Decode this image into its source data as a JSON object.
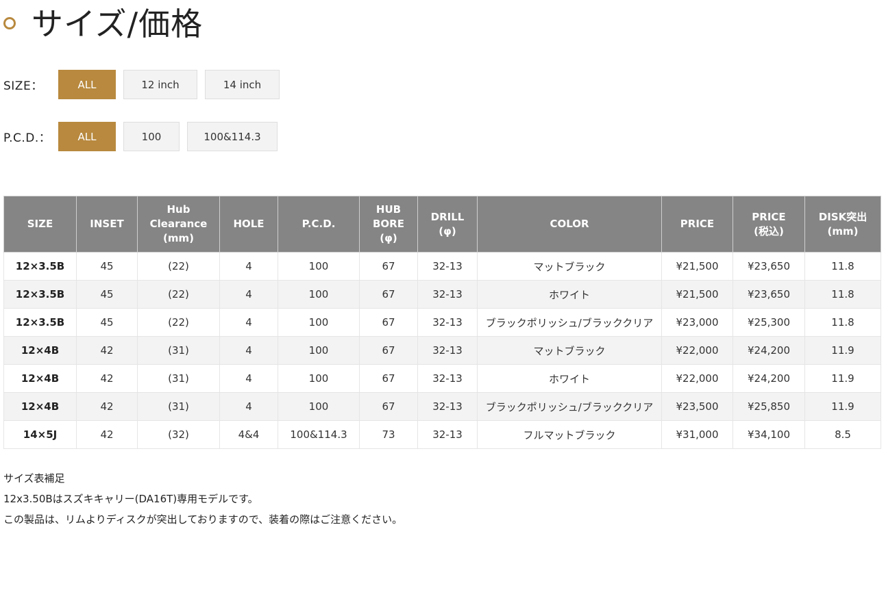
{
  "page_title": "サイズ/価格",
  "filters": {
    "size": {
      "label": "SIZE：",
      "options": [
        "ALL",
        "12 inch",
        "14 inch"
      ],
      "selected": "ALL"
    },
    "pcd": {
      "label": "P.C.D.：",
      "options": [
        "ALL",
        "100",
        "100&114.3"
      ],
      "selected": "ALL"
    }
  },
  "table": {
    "headers": [
      [
        "SIZE"
      ],
      [
        "INSET"
      ],
      [
        "Hub",
        "Clearance",
        "(mm)"
      ],
      [
        "HOLE"
      ],
      [
        "P.C.D."
      ],
      [
        "HUB",
        "BORE",
        "(φ)"
      ],
      [
        "DRILL",
        "(φ)"
      ],
      [
        "COLOR"
      ],
      [
        "PRICE"
      ],
      [
        "PRICE",
        "(税込)"
      ],
      [
        "DISK突出",
        "(mm)"
      ]
    ],
    "rows": [
      [
        "12×3.5B",
        "45",
        "(22)",
        "4",
        "100",
        "67",
        "32-13",
        "マットブラック",
        "¥21,500",
        "¥23,650",
        "11.8"
      ],
      [
        "12×3.5B",
        "45",
        "(22)",
        "4",
        "100",
        "67",
        "32-13",
        "ホワイト",
        "¥21,500",
        "¥23,650",
        "11.8"
      ],
      [
        "12×3.5B",
        "45",
        "(22)",
        "4",
        "100",
        "67",
        "32-13",
        "ブラックポリッシュ/ブラッククリア",
        "¥23,000",
        "¥25,300",
        "11.8"
      ],
      [
        "12×4B",
        "42",
        "(31)",
        "4",
        "100",
        "67",
        "32-13",
        "マットブラック",
        "¥22,000",
        "¥24,200",
        "11.9"
      ],
      [
        "12×4B",
        "42",
        "(31)",
        "4",
        "100",
        "67",
        "32-13",
        "ホワイト",
        "¥22,000",
        "¥24,200",
        "11.9"
      ],
      [
        "12×4B",
        "42",
        "(31)",
        "4",
        "100",
        "67",
        "32-13",
        "ブラックポリッシュ/ブラッククリア",
        "¥23,500",
        "¥25,850",
        "11.9"
      ],
      [
        "14×5J",
        "42",
        "(32)",
        "4&4",
        "100&114.3",
        "73",
        "32-13",
        "フルマットブラック",
        "¥31,000",
        "¥34,100",
        "8.5"
      ]
    ]
  },
  "notes": [
    "サイズ表補足",
    "12x3.50Bはスズキキャリー(DA16T)専用モデルです。",
    "この製品は、リムよりディスクが突出しておりますので、装着の際はご注意ください。"
  ],
  "colors": {
    "accent": "#b8893e",
    "header_bg": "#858585",
    "stripe": "#f3f3f3"
  }
}
